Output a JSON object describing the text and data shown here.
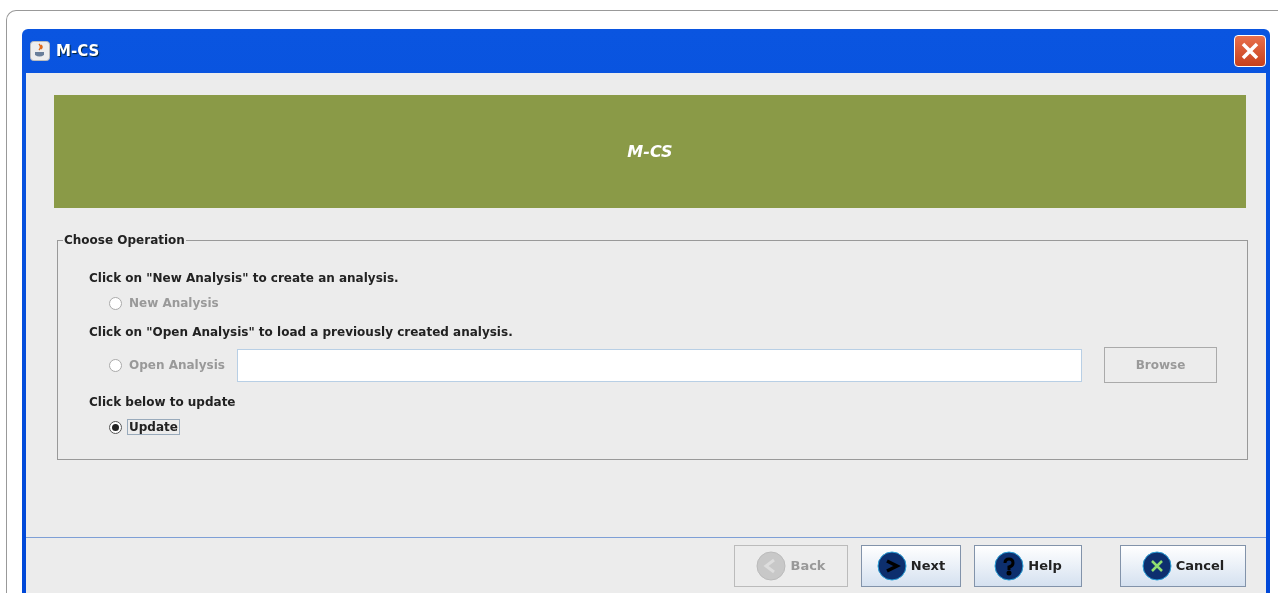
{
  "window": {
    "title": "M-CS"
  },
  "banner": {
    "title": "M-CS"
  },
  "group": {
    "title": "Choose Operation",
    "sections": [
      {
        "prompt": "Click on \"New Analysis\" to create an analysis.",
        "option": {
          "label": "New Analysis",
          "selected": false,
          "disabled": true
        }
      },
      {
        "prompt": "Click on \"Open Analysis\" to load a previously created analysis.",
        "option": {
          "label": "Open Analysis",
          "selected": false,
          "disabled": true
        },
        "browse": {
          "label": "Browse",
          "disabled": true
        }
      },
      {
        "prompt": "Click below to update",
        "option": {
          "label": "Update",
          "selected": true,
          "disabled": false
        }
      }
    ]
  },
  "buttons": [
    {
      "kind": "back",
      "label": "Back",
      "disabled": true
    },
    {
      "kind": "next",
      "label": "Next",
      "disabled": false
    },
    {
      "kind": "help",
      "label": "Help",
      "disabled": false
    },
    {
      "kind": "cancel",
      "label": "Cancel",
      "disabled": false
    }
  ]
}
